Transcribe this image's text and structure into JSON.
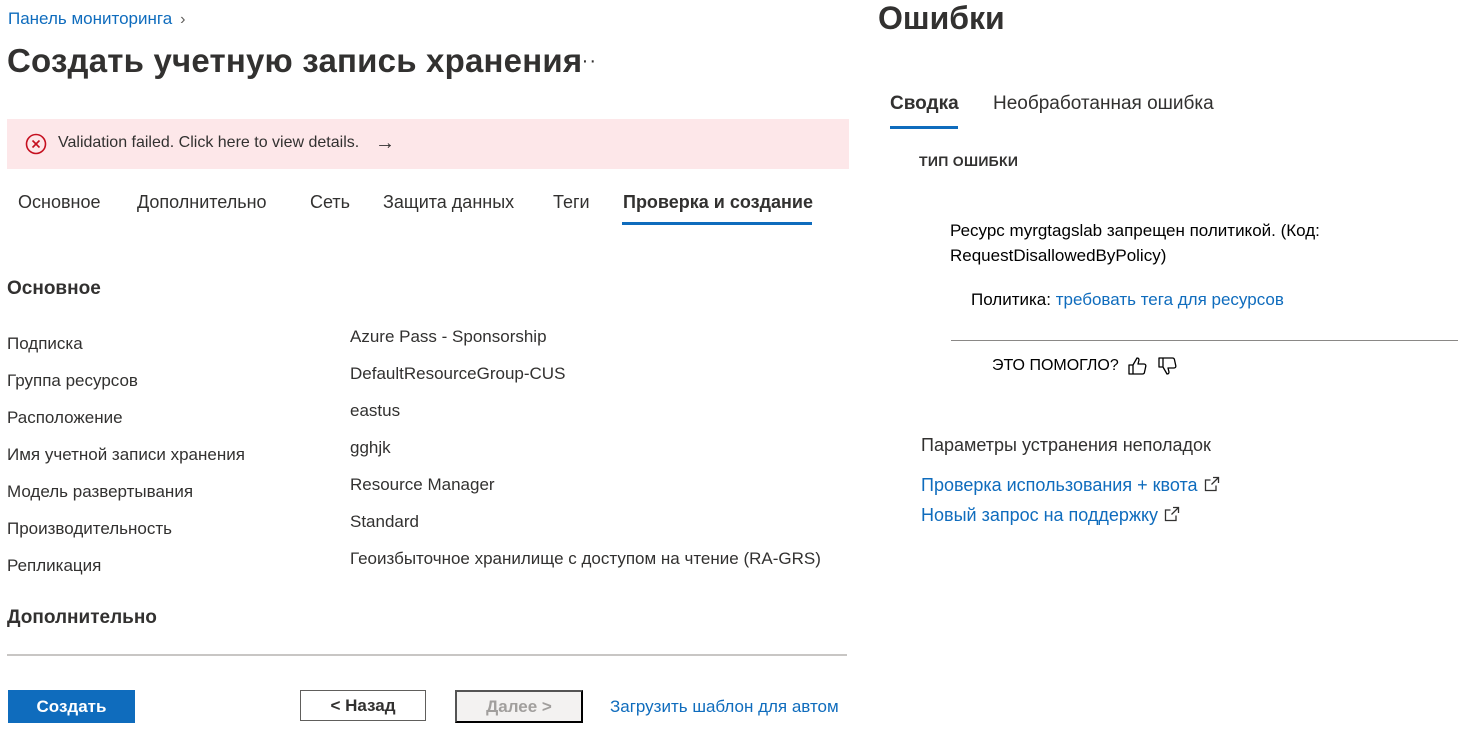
{
  "breadcrumb": {
    "label": "Панель мониторинга",
    "separator": "›"
  },
  "page": {
    "title": "Создать учетную запись хранения",
    "more": "···"
  },
  "banner": {
    "message": "Validation failed. Click here to view details.",
    "arrow": "→",
    "icon": "error-circle-icon",
    "bg": "#fde7e9",
    "icon_color": "#c50f1f"
  },
  "tabs": [
    {
      "label": "Основное"
    },
    {
      "label": "Дополнительно"
    },
    {
      "label": "Сеть"
    },
    {
      "label": "Защита данных"
    },
    {
      "label": "Теги"
    },
    {
      "label": "Проверка и создание",
      "active": true
    }
  ],
  "summary": {
    "basics_heading": "Основное",
    "rows": [
      {
        "label": "Подписка",
        "value": "Azure Pass - Sponsorship"
      },
      {
        "label": "Группа ресурсов",
        "value": "DefaultResourceGroup-CUS"
      },
      {
        "label": "Расположение",
        "value": "eastus"
      },
      {
        "label": "Имя учетной записи хранения",
        "value": "gghjk"
      },
      {
        "label": "Модель развертывания",
        "value": "Resource Manager"
      },
      {
        "label": "Производительность",
        "value": "Standard"
      },
      {
        "label": "Репликация",
        "value": "Геоизбыточное хранилище с доступом на чтение (RA-GRS)"
      }
    ],
    "advanced_heading": "Дополнительно"
  },
  "footer": {
    "create": "Создать",
    "back": "< Назад",
    "next": "Далее >",
    "template_link": "Загрузить шаблон для автом"
  },
  "errors_panel": {
    "title": "Ошибки",
    "tabs": [
      {
        "label": "Сводка",
        "active": true
      },
      {
        "label": "Необработанная ошибка"
      }
    ],
    "error_type_label": "ТИП ОШИБКИ",
    "error_text": "Ресурс myrgtagslab запрещен политикой. (Код: RequestDisallowedByPolicy)",
    "policy_label": "Политика: ",
    "policy_link": "требовать тега для ресурсов",
    "helpful_label": "ЭТО ПОМОГЛО?",
    "troubleshooting_title": "Параметры устранения неполадок",
    "links": [
      "Проверка использования + квота",
      "Новый запрос на поддержку"
    ]
  },
  "colors": {
    "accent": "#0f6cbd",
    "text": "#323130",
    "disabled_bg": "#f3f2f1",
    "disabled_text": "#a19f9d"
  }
}
